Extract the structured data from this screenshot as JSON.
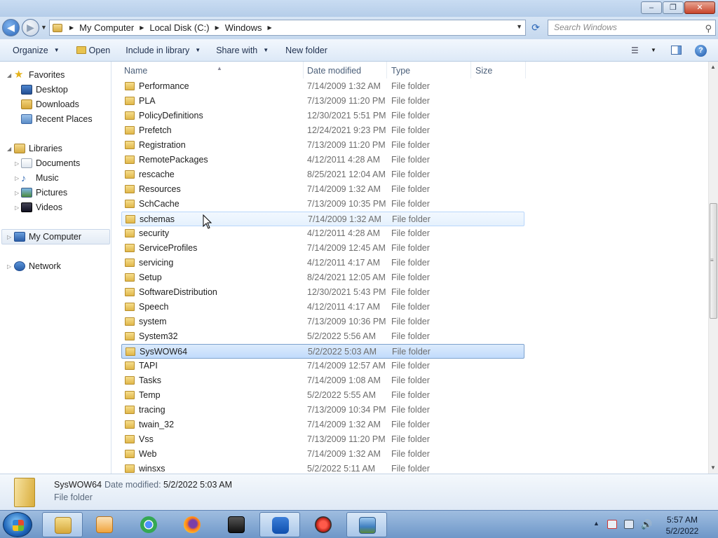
{
  "window": {
    "caption_buttons": {
      "minimize": "–",
      "maximize": "❐",
      "close": "✕"
    }
  },
  "address": {
    "crumbs": [
      "My Computer",
      "Local Disk (C:)",
      "Windows"
    ],
    "search_placeholder": "Search Windows"
  },
  "toolbar": {
    "organize": "Organize",
    "open": "Open",
    "include_in_library": "Include in library",
    "share_with": "Share with",
    "new_folder": "New folder"
  },
  "nav": {
    "favorites": "Favorites",
    "desktop": "Desktop",
    "downloads": "Downloads",
    "recent_places": "Recent Places",
    "libraries": "Libraries",
    "documents": "Documents",
    "music": "Music",
    "pictures": "Pictures",
    "videos": "Videos",
    "my_computer": "My Computer",
    "network": "Network"
  },
  "columns": {
    "name": "Name",
    "date": "Date modified",
    "type": "Type",
    "size": "Size"
  },
  "files": [
    {
      "name": "Performance",
      "date": "7/14/2009 1:32 AM",
      "type": "File folder"
    },
    {
      "name": "PLA",
      "date": "7/13/2009 11:20 PM",
      "type": "File folder"
    },
    {
      "name": "PolicyDefinitions",
      "date": "12/30/2021 5:51 PM",
      "type": "File folder"
    },
    {
      "name": "Prefetch",
      "date": "12/24/2021 9:23 PM",
      "type": "File folder"
    },
    {
      "name": "Registration",
      "date": "7/13/2009 11:20 PM",
      "type": "File folder"
    },
    {
      "name": "RemotePackages",
      "date": "4/12/2011 4:28 AM",
      "type": "File folder"
    },
    {
      "name": "rescache",
      "date": "8/25/2021 12:04 AM",
      "type": "File folder"
    },
    {
      "name": "Resources",
      "date": "7/14/2009 1:32 AM",
      "type": "File folder"
    },
    {
      "name": "SchCache",
      "date": "7/13/2009 10:35 PM",
      "type": "File folder"
    },
    {
      "name": "schemas",
      "date": "7/14/2009 1:32 AM",
      "type": "File folder"
    },
    {
      "name": "security",
      "date": "4/12/2011 4:28 AM",
      "type": "File folder"
    },
    {
      "name": "ServiceProfiles",
      "date": "7/14/2009 12:45 AM",
      "type": "File folder"
    },
    {
      "name": "servicing",
      "date": "4/12/2011 4:17 AM",
      "type": "File folder"
    },
    {
      "name": "Setup",
      "date": "8/24/2021 12:05 AM",
      "type": "File folder"
    },
    {
      "name": "SoftwareDistribution",
      "date": "12/30/2021 5:43 PM",
      "type": "File folder"
    },
    {
      "name": "Speech",
      "date": "4/12/2011 4:17 AM",
      "type": "File folder"
    },
    {
      "name": "system",
      "date": "7/13/2009 10:36 PM",
      "type": "File folder"
    },
    {
      "name": "System32",
      "date": "5/2/2022 5:56 AM",
      "type": "File folder"
    },
    {
      "name": "SysWOW64",
      "date": "5/2/2022 5:03 AM",
      "type": "File folder"
    },
    {
      "name": "TAPI",
      "date": "7/14/2009 12:57 AM",
      "type": "File folder"
    },
    {
      "name": "Tasks",
      "date": "7/14/2009 1:08 AM",
      "type": "File folder"
    },
    {
      "name": "Temp",
      "date": "5/2/2022 5:55 AM",
      "type": "File folder"
    },
    {
      "name": "tracing",
      "date": "7/13/2009 10:34 PM",
      "type": "File folder"
    },
    {
      "name": "twain_32",
      "date": "7/14/2009 1:32 AM",
      "type": "File folder"
    },
    {
      "name": "Vss",
      "date": "7/13/2009 11:20 PM",
      "type": "File folder"
    },
    {
      "name": "Web",
      "date": "7/14/2009 1:32 AM",
      "type": "File folder"
    },
    {
      "name": "winsxs",
      "date": "5/2/2022 5:11 AM",
      "type": "File folder"
    }
  ],
  "selected_file": "SysWOW64",
  "hovered_file": "schemas",
  "details": {
    "name": "SysWOW64",
    "date_label": "Date modified:",
    "date": "5/2/2022 5:03 AM",
    "type": "File folder"
  },
  "taskbar": {
    "apps": [
      "file-explorer",
      "media-player",
      "chrome",
      "firefox",
      "mpc-be",
      "malwarebytes",
      "security-app",
      "photo-viewer"
    ],
    "time": "5:57 AM",
    "date": "5/2/2022"
  }
}
